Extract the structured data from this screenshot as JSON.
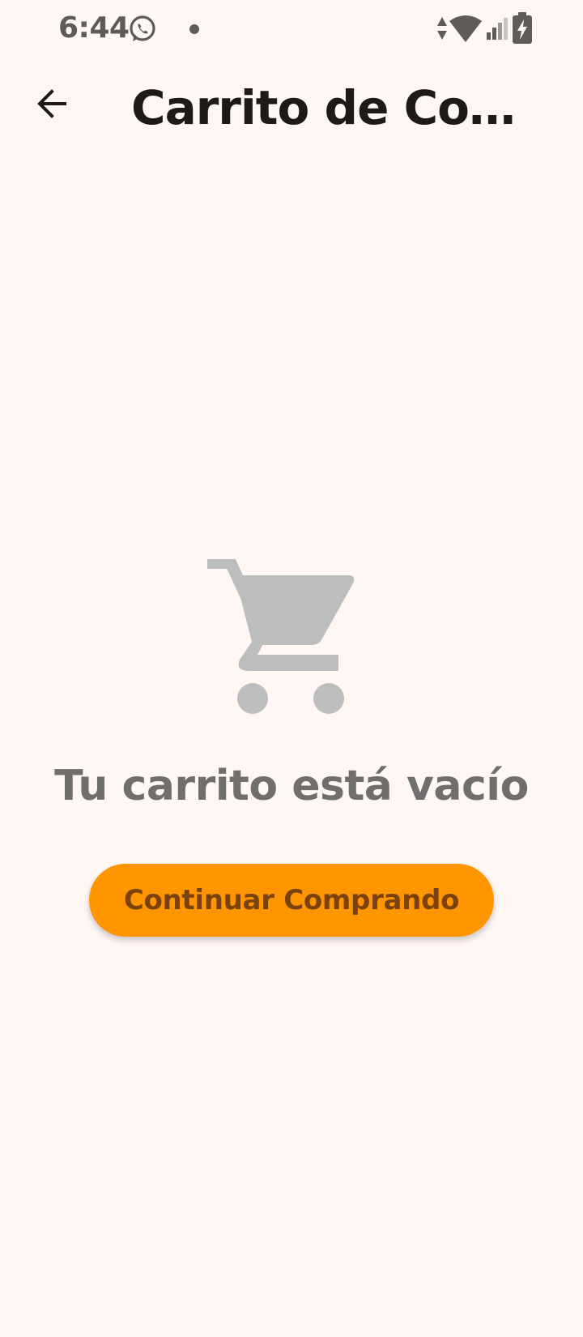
{
  "status_bar": {
    "time": "6:44",
    "icons": [
      "whatsapp-icon",
      "notification-dot-icon",
      "data-arrows-icon",
      "wifi-icon",
      "signal-icon",
      "battery-charging-icon"
    ]
  },
  "app_bar": {
    "title": "Carrito de Compras",
    "back_icon": "arrow-back-icon"
  },
  "empty_state": {
    "icon": "shopping-cart-icon",
    "message": "Tu carrito está vacío",
    "button_label": "Continuar Comprando"
  },
  "colors": {
    "background": "#FFF7F4",
    "accent": "#FF9500",
    "button_text": "#7A420C",
    "icon_gray": "#BDBDBD",
    "message_text": "#716F6E"
  }
}
